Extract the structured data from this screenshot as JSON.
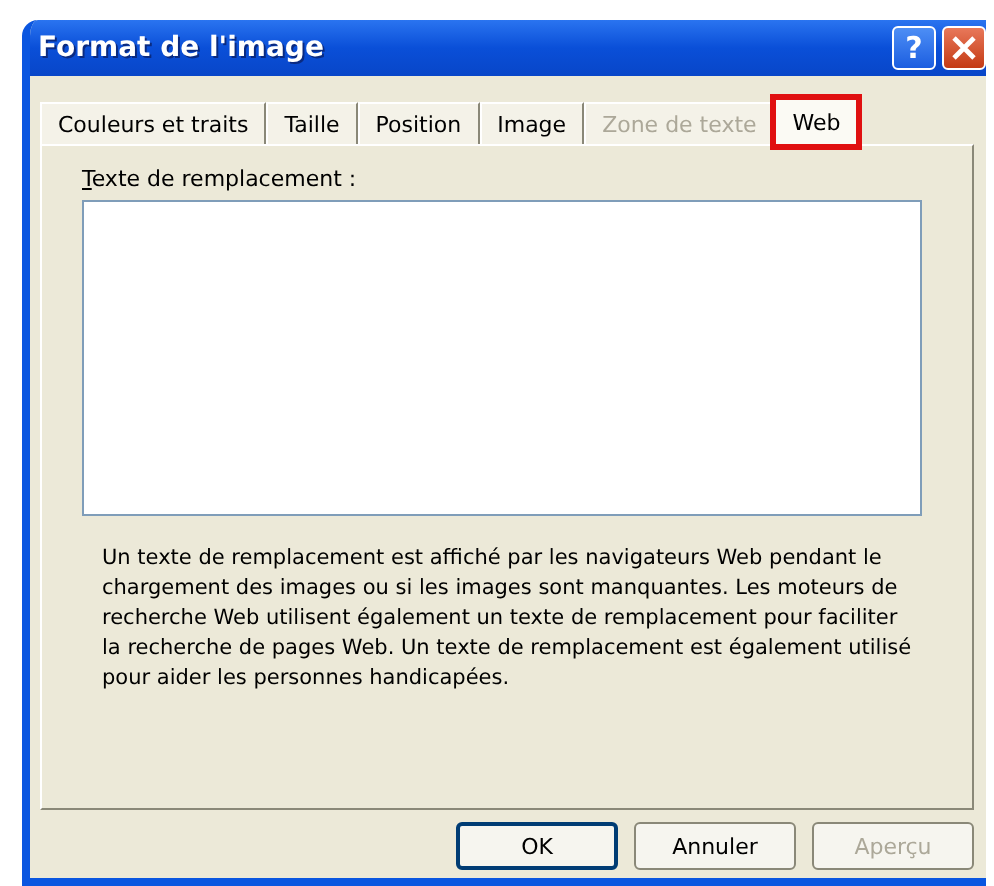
{
  "window": {
    "title": "Format de l'image",
    "help_label": "?"
  },
  "tabs": [
    {
      "label": "Couleurs et traits",
      "selected": false,
      "disabled": false,
      "highlighted": false
    },
    {
      "label": "Taille",
      "selected": false,
      "disabled": false,
      "highlighted": false
    },
    {
      "label": "Position",
      "selected": false,
      "disabled": false,
      "highlighted": false
    },
    {
      "label": "Image",
      "selected": false,
      "disabled": false,
      "highlighted": false
    },
    {
      "label": "Zone de texte",
      "selected": false,
      "disabled": true,
      "highlighted": false
    },
    {
      "label": "Web",
      "selected": true,
      "disabled": false,
      "highlighted": true
    }
  ],
  "alt_text": {
    "label": "Texte de remplacement :"
  },
  "description": "Un texte de remplacement est affiché par les navigateurs Web pendant le chargement des images ou si les images sont manquantes. Les moteurs de recherche Web utilisent également un texte de remplacement pour faciliter la recherche de pages Web. Un texte de remplacement est également utilisé pour aider les personnes handicapées.",
  "buttons": [
    {
      "label": "OK",
      "disabled": false,
      "default": true
    },
    {
      "label": "Annuler",
      "disabled": false,
      "default": false
    },
    {
      "label": "Aperçu",
      "disabled": true,
      "default": false
    }
  ]
}
